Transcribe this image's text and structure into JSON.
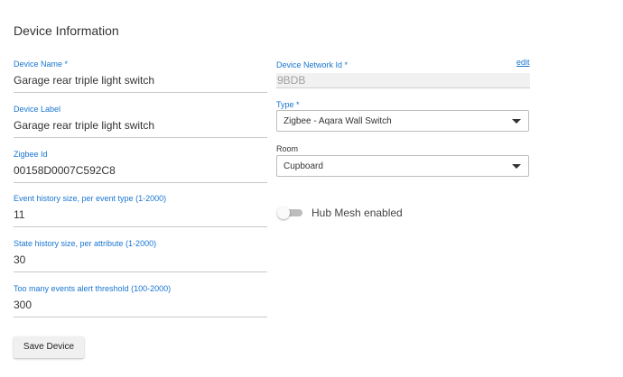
{
  "section": {
    "title": "Device Information"
  },
  "fields": {
    "device_name": {
      "label": "Device Name *",
      "value": "Garage rear triple light switch"
    },
    "device_label": {
      "label": "Device Label",
      "value": "Garage rear triple light switch"
    },
    "zigbee_id": {
      "label": "Zigbee Id",
      "value": "00158D0007C592C8"
    },
    "event_history": {
      "label": "Event history size, per event type (1-2000)",
      "value": "11"
    },
    "state_history": {
      "label": "State history size, per attribute (1-2000)",
      "value": "30"
    },
    "alert_threshold": {
      "label": "Too many events alert threshold (100-2000)",
      "value": "300"
    }
  },
  "network": {
    "label": "Device Network Id *",
    "value": "9BDB",
    "edit_label": "edit"
  },
  "type": {
    "label": "Type *",
    "selected": "Zigbee - Aqara Wall Switch"
  },
  "room": {
    "label": "Room",
    "selected": "Cupboard"
  },
  "hub_mesh": {
    "label": "Hub Mesh enabled",
    "enabled": false
  },
  "actions": {
    "save_label": "Save Device"
  },
  "colors": {
    "accent": "#1976d2",
    "text": "#333333",
    "disabled_bg": "#f1f1f1"
  }
}
